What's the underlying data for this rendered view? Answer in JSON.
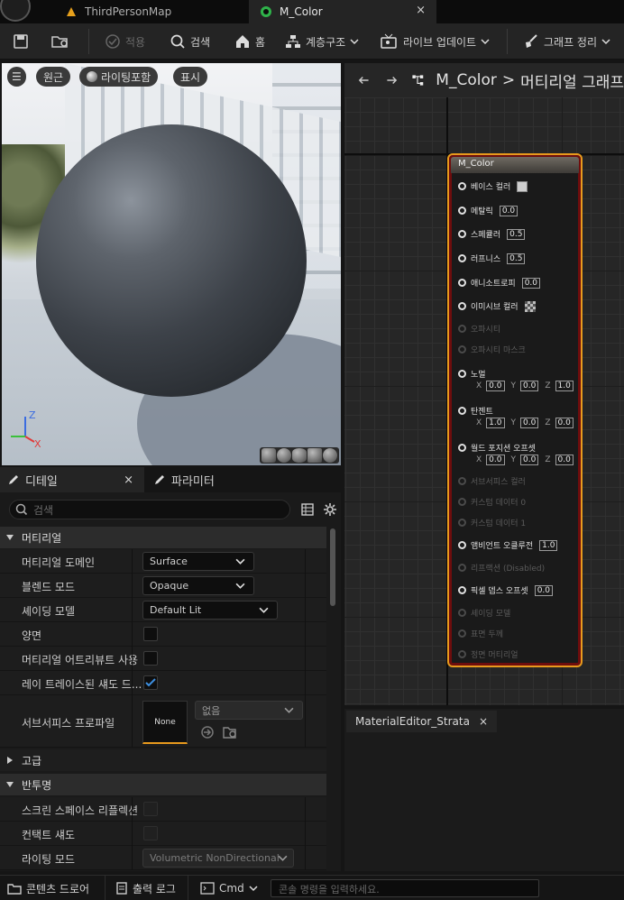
{
  "tabs": [
    {
      "label": "ThirdPersonMap"
    },
    {
      "label": "M_Color",
      "close": "×"
    }
  ],
  "toolbar": {
    "apply": "적용",
    "search": "검색",
    "home": "홈",
    "hierarchy": "계층구조",
    "live_update": "라이브 업데이트",
    "clean_graph": "그래프 정리"
  },
  "viewport": {
    "menu": "☰",
    "perspective": "원근",
    "lighting": "라이팅포함",
    "show": "표시",
    "axis_z": "Z",
    "axis_x": "X"
  },
  "details": {
    "tab_details": "디테일",
    "tab_close": "×",
    "tab_params": "파라미터",
    "search_placeholder": "검색",
    "cat_material": "머티리얼",
    "rows": [
      {
        "label": "머티리얼 도메인",
        "value": "Surface"
      },
      {
        "label": "블렌드 모드",
        "value": "Opaque"
      },
      {
        "label": "셰이딩 모델",
        "value": "Default Lit"
      },
      {
        "label": "양면"
      },
      {
        "label": "머티리얼 어트리뷰트 사용"
      },
      {
        "label": "레이 트레이스된 섀도 드..."
      },
      {
        "label": "서브서피스 프로파일",
        "thumb": "None",
        "value": "없음"
      }
    ],
    "cat_advanced": "고급",
    "cat_translucency": "반투명",
    "rows2": [
      {
        "label": "스크린 스페이스 리플렉션"
      },
      {
        "label": "컨택트 섀도"
      },
      {
        "label": "라이팅 모드",
        "value": "Volumetric NonDirectional"
      }
    ]
  },
  "graph": {
    "breadcrumb_asset": "M_Color",
    "breadcrumb_sep": ">",
    "breadcrumb_path": "머티리얼 그래프",
    "node_title": "M_Color",
    "pins": [
      {
        "label": "베이스 컬러",
        "enabled": true
      },
      {
        "label": "메탈릭",
        "value": "0.0",
        "enabled": true
      },
      {
        "label": "스페큘러",
        "value": "0.5",
        "enabled": true
      },
      {
        "label": "러프니스",
        "value": "0.5",
        "enabled": true
      },
      {
        "label": "애니소트로피",
        "value": "0.0",
        "enabled": true
      },
      {
        "label": "이미시브 컬러",
        "enabled": true
      },
      {
        "label": "오파시티",
        "enabled": false
      },
      {
        "label": "오파시티 마스크",
        "enabled": false
      },
      {
        "label": "노멀",
        "enabled": true,
        "x": "0.0",
        "y": "0.0",
        "z": "1.0"
      },
      {
        "label": "탄젠트",
        "enabled": true,
        "x": "1.0",
        "y": "0.0",
        "z": "0.0"
      },
      {
        "label": "월드 포지션 오프셋",
        "enabled": true,
        "x": "0.0",
        "y": "0.0",
        "z": "0.0"
      },
      {
        "label": "서브서피스 컬러",
        "enabled": false
      },
      {
        "label": "커스텀 데이터 0",
        "enabled": false
      },
      {
        "label": "커스텀 데이터 1",
        "enabled": false
      },
      {
        "label": "앰비언트 오클루전",
        "value": "1.0",
        "enabled": true
      },
      {
        "label": "리프랙션 (Disabled)",
        "enabled": false
      },
      {
        "label": "픽셀 뎁스 오프셋",
        "value": "0.0",
        "enabled": true
      },
      {
        "label": "셰이딩 모델",
        "enabled": false
      },
      {
        "label": "표면 두께",
        "enabled": false
      },
      {
        "label": "정면 머티리얼",
        "enabled": false
      }
    ],
    "axis_x": "X",
    "axis_y": "Y",
    "axis_z": "Z"
  },
  "strata": {
    "tab": "MaterialEditor_Strata",
    "close": "×"
  },
  "statusbar": {
    "content_drawer": "콘텐츠 드로어",
    "output_log": "출력 로그",
    "cmd": "Cmd",
    "cmd_placeholder": "콘솔 명령을 입력하세요."
  },
  "colors": {
    "accent": "#e89a1d",
    "check": "#3d8fe0"
  }
}
